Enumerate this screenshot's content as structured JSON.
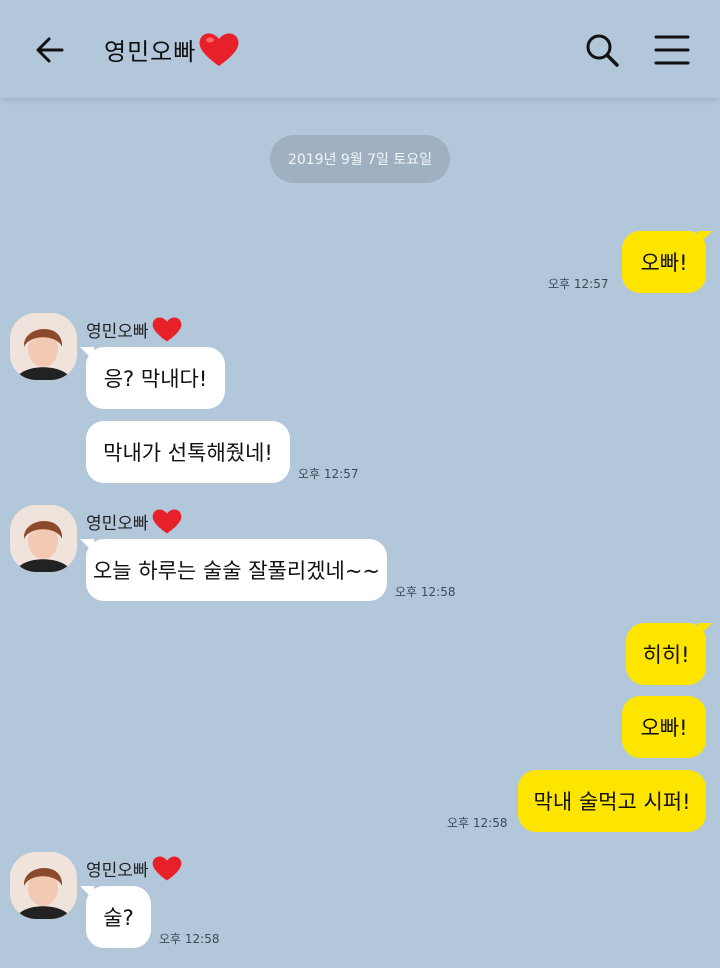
{
  "header": {
    "title": "영민오빠",
    "heart_color": "#e8202a",
    "icons": [
      "back-arrow-icon",
      "heart-icon",
      "search-icon",
      "menu-icon"
    ]
  },
  "date_divider": "2019년 9월 7일 토요일",
  "messages": [
    {
      "side": "mine",
      "text": "오빠!",
      "time": "오후 12:57"
    },
    {
      "side": "theirs",
      "sender": "영민오빠",
      "text": "응? 막내다!"
    },
    {
      "side": "theirs",
      "text": "막내가 선톡해줬네!",
      "time": "오후 12:57"
    },
    {
      "side": "theirs",
      "sender": "영민오빠",
      "text": "오늘 하루는 술술 잘풀리겠네~~",
      "time": "오후 12:58"
    },
    {
      "side": "mine",
      "text": "히히!"
    },
    {
      "side": "mine",
      "text": "오빠!"
    },
    {
      "side": "mine",
      "text": "막내 술먹고 시퍼!",
      "time": "오후 12:58"
    },
    {
      "side": "theirs",
      "sender": "영민오빠",
      "text": "술?",
      "time": "오후 12:58"
    }
  ],
  "colors": {
    "background": "#b2c7da",
    "my_bubble": "#fee500",
    "their_bubble": "#ffffff",
    "date_pill": "#9fb0c1"
  }
}
